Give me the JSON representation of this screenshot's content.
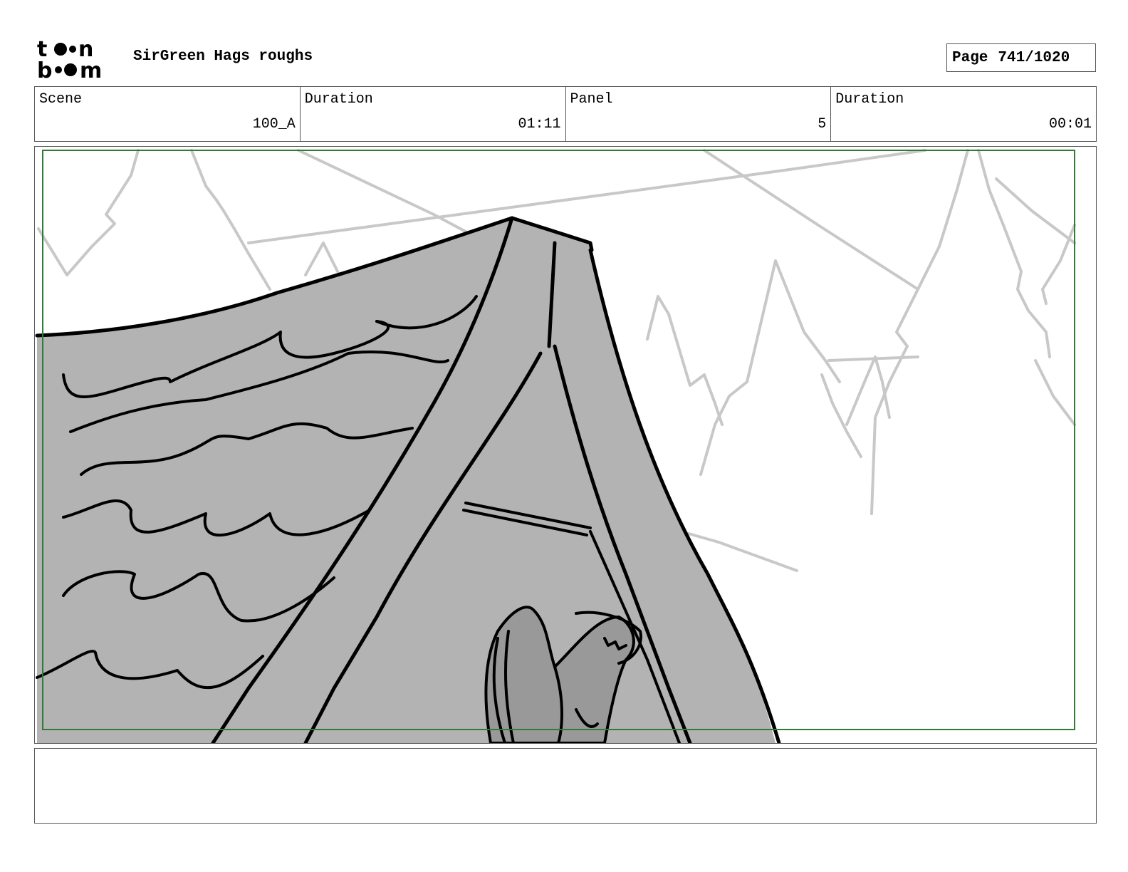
{
  "header": {
    "logo_text": "toon boom",
    "title": "SirGreen Hags roughs",
    "page_label": "Page",
    "page_number": "741/1020"
  },
  "info": {
    "scene_label": "Scene",
    "scene_value": "100_A",
    "scene_duration_label": "Duration",
    "scene_duration_value": "01:11",
    "panel_label": "Panel",
    "panel_value": "5",
    "panel_duration_label": "Duration",
    "panel_duration_value": "00:01"
  },
  "panel": {
    "safe_frame_color": "#2e7d32",
    "tent_fill": "#b3b3b3",
    "creature_fill": "#999999",
    "background_sketch_color": "#c8c8c8"
  },
  "notes": {
    "text": ""
  }
}
